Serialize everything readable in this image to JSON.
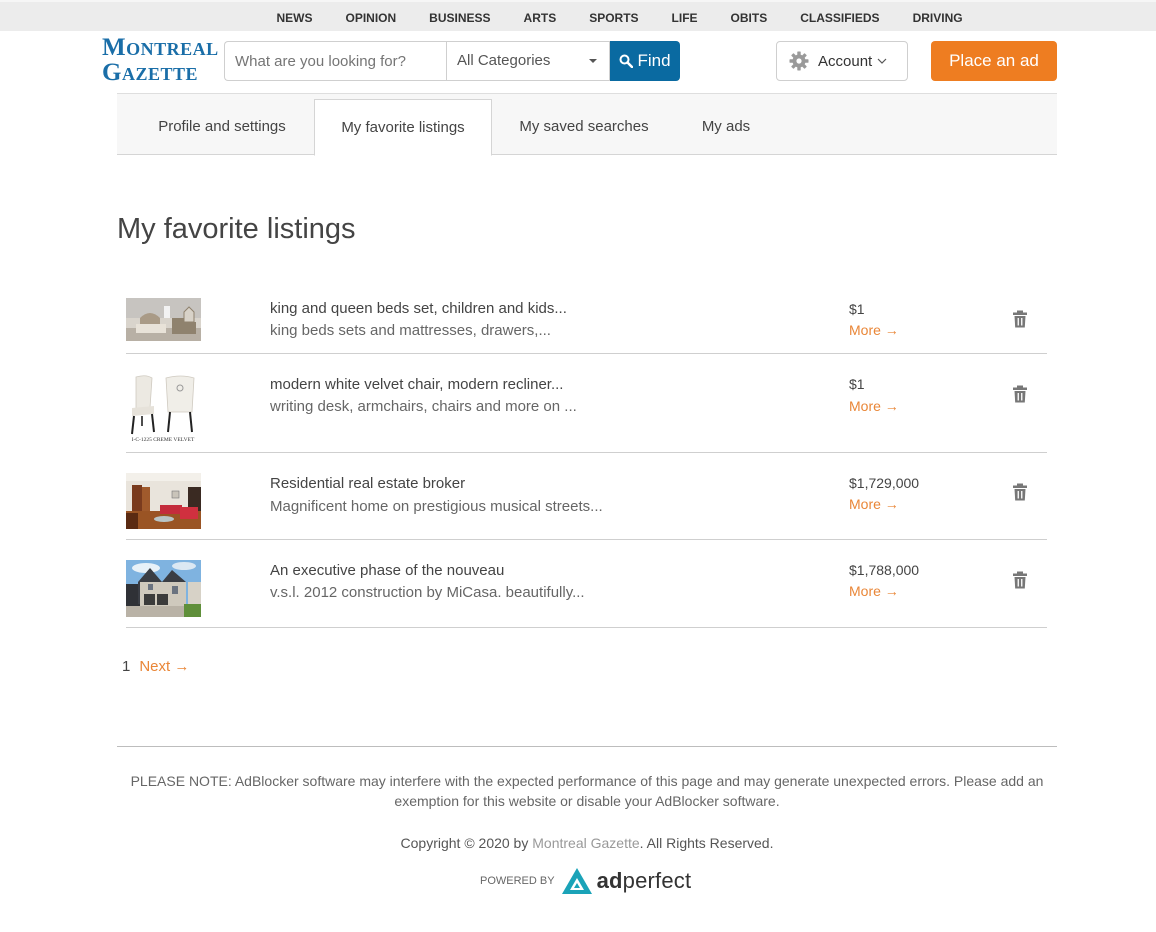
{
  "top_nav": [
    "NEWS",
    "OPINION",
    "BUSINESS",
    "ARTS",
    "SPORTS",
    "LIFE",
    "OBITS",
    "CLASSIFIEDS",
    "DRIVING"
  ],
  "header": {
    "logo_line1": "Montreal",
    "logo_line2": "Gazette",
    "search_placeholder": "What are you looking for?",
    "search_value": "",
    "category_selected": "All Categories",
    "find_label": "Find",
    "account_label": "Account",
    "place_ad_label": "Place an ad"
  },
  "tabs": [
    {
      "label": "Profile and settings",
      "active": false
    },
    {
      "label": "My favorite listings",
      "active": true
    },
    {
      "label": "My saved searches",
      "active": false
    },
    {
      "label": "My ads",
      "active": false
    }
  ],
  "page_title": "My favorite listings",
  "listings": [
    {
      "title": "king and queen beds set, children and kids...",
      "description": "king beds sets and mattresses, drawers,...",
      "price": "$1",
      "more_label": "More →",
      "thumbnail": "bedroom-set-photo"
    },
    {
      "title": "modern white velvet chair, modern recliner...",
      "description": "writing desk, armchairs, chairs and more on ...",
      "price": "$1",
      "more_label": "More →",
      "thumbnail": "velvet-chairs-photo",
      "thumbnail_caption": "I-C-1225 CREME VELVET"
    },
    {
      "title": "Residential real estate broker",
      "description": "Magnificent home on prestigious musical streets...",
      "price": "$1,729,000",
      "more_label": "More →",
      "thumbnail": "living-room-photo"
    },
    {
      "title": "An executive phase of the nouveau",
      "description": "v.s.l. 2012 construction by MiCasa. beautifully...",
      "price": "$1,788,000",
      "more_label": "More →",
      "thumbnail": "house-exterior-photo"
    }
  ],
  "pagination": {
    "current": "1",
    "next_label": "Next →"
  },
  "footer": {
    "note": "PLEASE NOTE: AdBlocker software may interfere with the expected performance of this page and may generate unexpected errors. Please add an exemption for this website or disable your AdBlocker software.",
    "copyright_prefix": "Copyright © 2020 by ",
    "copyright_brand": "Montreal Gazette",
    "copyright_suffix": ". All Rights Reserved.",
    "powered_by": "POWERED BY",
    "powered_brand_bold": "ad",
    "powered_brand_rest": "perfect"
  },
  "colors": {
    "accent_orange": "#ee7d21",
    "link_orange": "#e98637",
    "find_blue": "#0a6aa1",
    "logo_blue": "#1a6ea8",
    "adperfect_teal": "#1aa3b8"
  }
}
